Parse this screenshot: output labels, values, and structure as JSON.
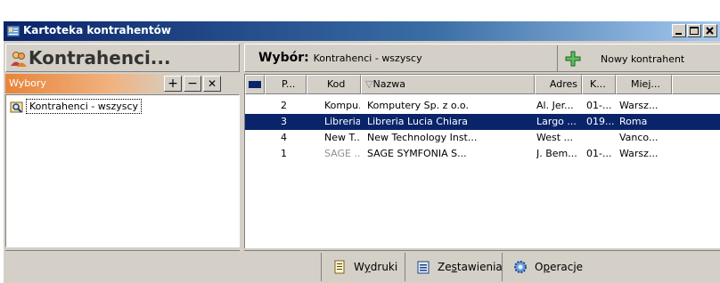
{
  "window": {
    "title": "Kartoteka kontrahentów",
    "icon": "address-card-icon",
    "controls": [
      "minimize-icon",
      "maximize-icon",
      "close-icon"
    ]
  },
  "left": {
    "header_title": "Kontrahenci...",
    "header_icon": "people-icon",
    "wybory_label": "Wybory",
    "buttons": {
      "add": "+",
      "remove": "−",
      "close": "✕"
    },
    "tree_items": [
      {
        "label": "Kontrahenci - wszyscy",
        "icon": "search-folder-icon"
      }
    ]
  },
  "right": {
    "wybor_label": "Wybór:",
    "wybor_value": "Kontrahenci - wszyscy",
    "new_button": {
      "icon": "green-plus-icon",
      "label": "Nowy kontrahent"
    }
  },
  "grid": {
    "columns": [
      "P...",
      "Kod",
      "Nazwa",
      "Adres",
      "K...",
      "Miej..."
    ],
    "sort_indicator": "▽",
    "rows": [
      {
        "p": "2",
        "kod": "Kompu...",
        "nazwa": "Komputery Sp. z o.o.",
        "adres": "Al. Jer...",
        "k": "01-...",
        "miej": "Warsz...",
        "state": "normal"
      },
      {
        "p": "3",
        "kod": "Libreria...",
        "nazwa": "Libreria Lucia Chiara",
        "adres": "Largo ...",
        "k": "019...",
        "miej": "Roma",
        "state": "selected"
      },
      {
        "p": "4",
        "kod": "New T...",
        "nazwa": "New Technology Inst...",
        "adres": "West ...",
        "k": "",
        "miej": "Vanco...",
        "state": "normal"
      },
      {
        "p": "1",
        "kod": "SAGE ...",
        "nazwa": "SAGE SYMFONIA S...",
        "adres": "J. Bem...",
        "k": "01-...",
        "miej": "Warsz...",
        "state": "grey-kod"
      }
    ]
  },
  "bottom": {
    "buttons": [
      {
        "pre": "W",
        "ul": "y",
        "post": "druki",
        "icon": "printer-doc-icon"
      },
      {
        "pre": "Ze",
        "ul": "s",
        "post": "tawienia",
        "icon": "report-icon"
      },
      {
        "pre": "O",
        "ul": "p",
        "post": "eracje",
        "icon": "gear-icon"
      }
    ]
  },
  "colors": {
    "title_start": "#0a246a",
    "title_end": "#a6caf0",
    "selection": "#0a246a",
    "wybory_orange": "#e8843a",
    "face": "#d4d0c8"
  }
}
